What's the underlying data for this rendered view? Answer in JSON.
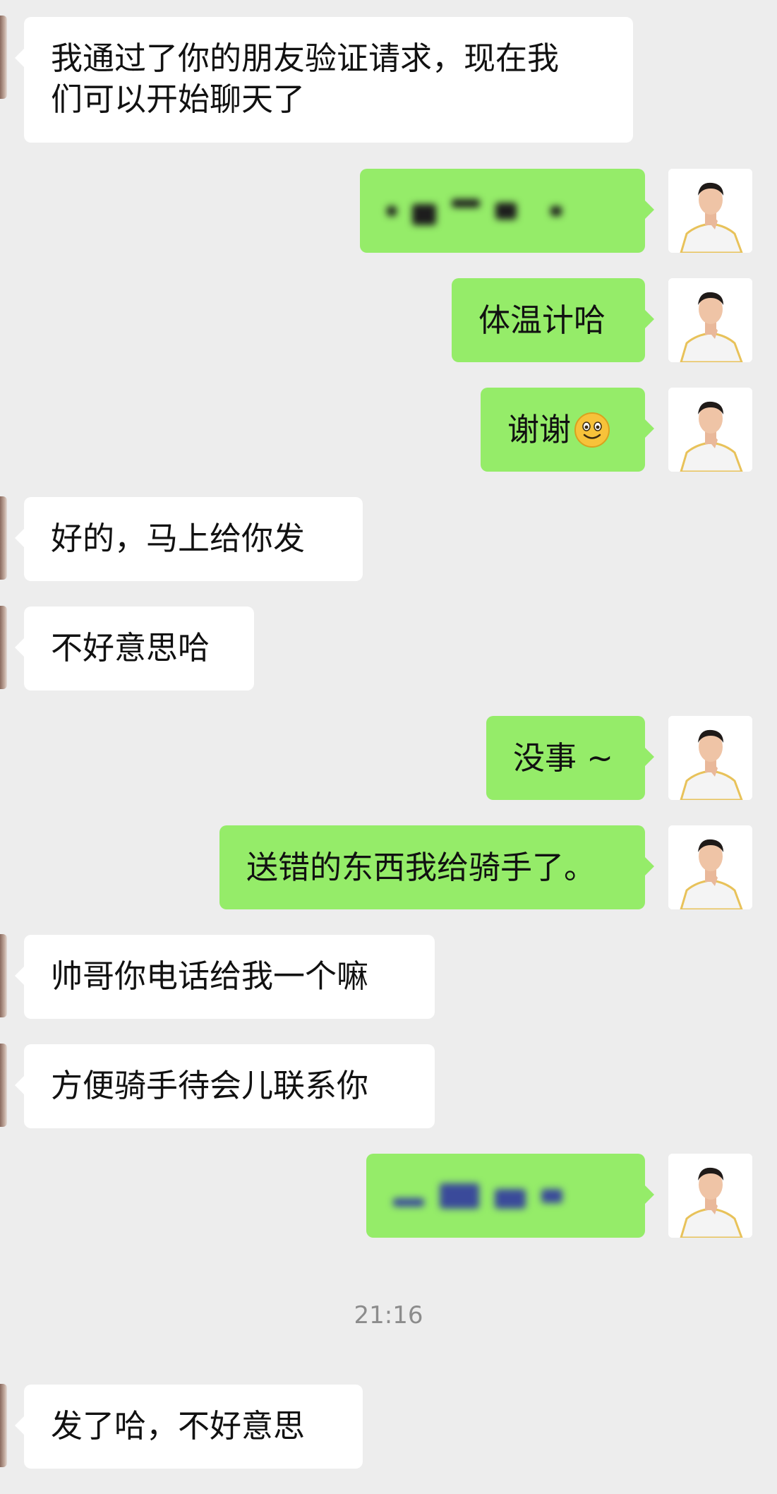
{
  "messages": [
    {
      "from": "other",
      "text_line1": "我通过了你的朋友验证请求，现在我",
      "text_line2": "们可以开始聊天了"
    },
    {
      "from": "me",
      "redacted": true
    },
    {
      "from": "me",
      "text": "体温计哈"
    },
    {
      "from": "me",
      "text": "谢谢",
      "emoji": "smiley-icon"
    },
    {
      "from": "other",
      "text": "好的，马上给你发"
    },
    {
      "from": "other",
      "text": "不好意思哈"
    },
    {
      "from": "me",
      "text": "没事 ~"
    },
    {
      "from": "me",
      "text": "送错的东西我给骑手了。"
    },
    {
      "from": "other",
      "text": "帅哥你电话给我一个嘛"
    },
    {
      "from": "other",
      "text": "方便骑手待会儿联系你"
    },
    {
      "from": "me",
      "redacted": true
    },
    {
      "from": "other",
      "text": "发了哈，不好意思"
    }
  ],
  "timestamp": "21:16",
  "colors": {
    "background": "#ededed",
    "outgoing_bubble": "#95ec69",
    "incoming_bubble": "#ffffff"
  }
}
